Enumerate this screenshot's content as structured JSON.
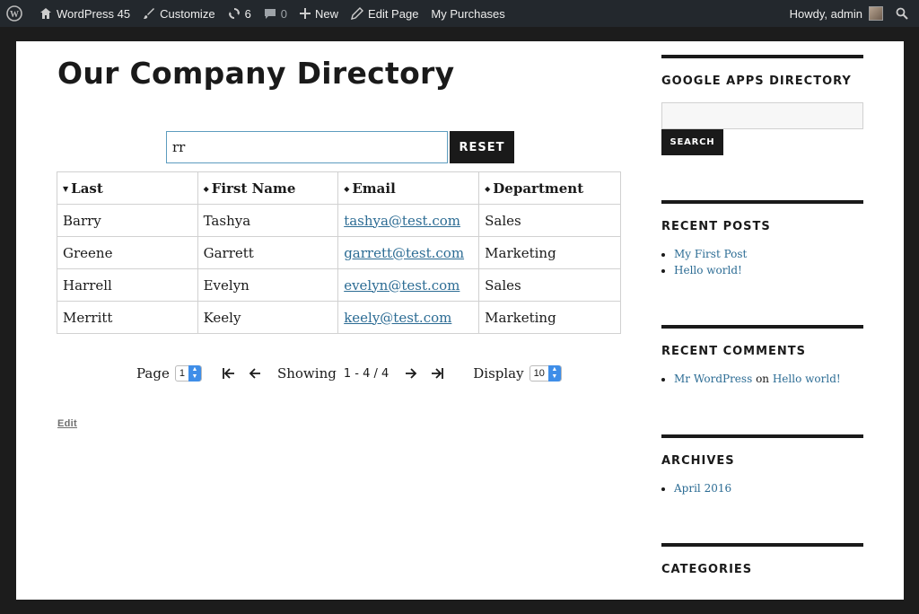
{
  "adminbar": {
    "site": "WordPress 45",
    "customize": "Customize",
    "updates": "6",
    "comments": "0",
    "new": "New",
    "edit_page": "Edit Page",
    "purchases": "My Purchases",
    "howdy": "Howdy, admin"
  },
  "page": {
    "title": "Our Company Directory",
    "search_value": "rr",
    "reset_label": "RESET",
    "edit_label": "Edit"
  },
  "table": {
    "headers": [
      "Last",
      "First Name",
      "Email",
      "Department"
    ],
    "rows": [
      [
        "Barry",
        "Tashya",
        "tashya@test.com",
        "Sales"
      ],
      [
        "Greene",
        "Garrett",
        "garrett@test.com",
        "Marketing"
      ],
      [
        "Harrell",
        "Evelyn",
        "evelyn@test.com",
        "Sales"
      ],
      [
        "Merritt",
        "Keely",
        "keely@test.com",
        "Marketing"
      ]
    ]
  },
  "pager": {
    "page_label": "Page",
    "page_value": "1",
    "showing_label": "Showing",
    "showing_range": "1 - 4 / 4",
    "display_label": "Display",
    "display_value": "10"
  },
  "sidebar": {
    "ga_title": "GOOGLE APPS DIRECTORY",
    "ga_search_label": "SEARCH",
    "recent_posts_title": "RECENT POSTS",
    "recent_posts": [
      "My First Post",
      "Hello world!"
    ],
    "recent_comments_title": "RECENT COMMENTS",
    "comment_author": "Mr WordPress",
    "comment_on": "on",
    "comment_post": "Hello world!",
    "archives_title": "ARCHIVES",
    "archives": [
      "April 2016"
    ],
    "categories_title": "CATEGORIES"
  },
  "colors": {
    "adminbar_bg": "#23282d",
    "link": "#2c6c94",
    "button_bg": "#1a1a1a",
    "focus_border": "#5d9cbf"
  }
}
